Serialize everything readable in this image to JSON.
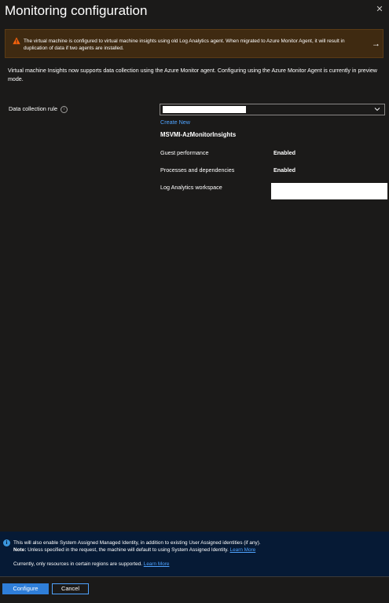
{
  "header": {
    "title": "Monitoring configuration",
    "close_icon": "close-icon",
    "close_glyph": "✕"
  },
  "warning": {
    "icon": "warning-icon",
    "text": "The virtual machine is configured to virtual machine insights using old Log Analytics agent. When migrated to Azure Monitor Agent, it will result in duplication of data if two agents are installed.",
    "arrow": "→",
    "background": "#3f2a11",
    "icon_color": "#f7630c"
  },
  "intro": {
    "text": "Virtual machine Insights now supports data collection using the Azure Monitor agent. Configuring using the Azure Monitor Agent is currently in preview mode."
  },
  "form": {
    "dcr_label": "Data collection rule",
    "info_glyph": "i",
    "dcr_selected_value_redacted": true,
    "create_new": "Create New",
    "dcr_name": "MSVMI-AzMonitorInsights",
    "rows": [
      {
        "label": "Guest performance",
        "value": "Enabled"
      },
      {
        "label": "Processes and dependencies",
        "value": "Enabled"
      },
      {
        "label": "Log Analytics workspace",
        "value_redacted": true
      }
    ]
  },
  "info_bar": {
    "icon": "info-icon",
    "icon_glyph": "i",
    "line1": "This will also enable System Assigned Managed Identity, in addition to existing User Assigned identities (if any).",
    "note_label": "Note:",
    "note_text": " Unless specified in the request, the machine will default to using System Assigned Identity. ",
    "note_link": "Learn More",
    "line3": "Currently, only resources in certain regions are supported. ",
    "line3_link": "Learn More",
    "background": "#061a35"
  },
  "footer": {
    "configure_label": "Configure",
    "cancel_label": "Cancel",
    "accent": "#2f7ed8"
  }
}
